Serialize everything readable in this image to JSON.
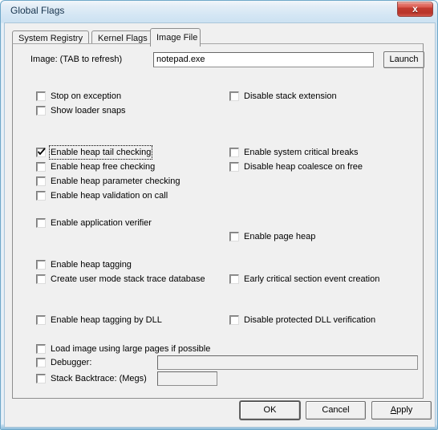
{
  "window": {
    "title": "Global Flags",
    "close_label": "x",
    "close_icon": "close-icon",
    "accent_close": "#c23c31",
    "frame_accent": "#6fa8c9",
    "dialog_background": "#f0f0f0"
  },
  "tabs": [
    {
      "label": "System Registry",
      "active": false
    },
    {
      "label": "Kernel Flags",
      "active": false
    },
    {
      "label": "Image File",
      "active": true
    }
  ],
  "image_row": {
    "label": "Image: (TAB to refresh)",
    "value": "notepad.exe",
    "placeholder": "",
    "launch_label": "Launch"
  },
  "left_column": [
    {
      "label": "Stop on exception",
      "checked": false,
      "focus": false,
      "enabled": true
    },
    {
      "label": "Show loader snaps",
      "checked": false,
      "focus": false,
      "enabled": true
    },
    {
      "label": "Enable heap tail checking",
      "checked": true,
      "focus": true,
      "enabled": true
    },
    {
      "label": "Enable heap free checking",
      "checked": false,
      "focus": false,
      "enabled": true
    },
    {
      "label": "Enable heap parameter checking",
      "checked": false,
      "focus": false,
      "enabled": true
    },
    {
      "label": "Enable heap validation on call",
      "checked": false,
      "focus": false,
      "enabled": true
    },
    {
      "label": "Enable application verifier",
      "checked": false,
      "focus": false,
      "enabled": true
    },
    {
      "label": "Enable heap tagging",
      "checked": false,
      "focus": false,
      "enabled": true
    },
    {
      "label": "Create user mode stack trace database",
      "checked": false,
      "focus": false,
      "enabled": true
    },
    {
      "label": "Enable heap tagging by DLL",
      "checked": false,
      "focus": false,
      "enabled": true
    },
    {
      "label": "Load image using large pages if possible",
      "checked": false,
      "focus": false,
      "enabled": true
    }
  ],
  "right_column": [
    {
      "label": "Disable stack extension",
      "checked": false,
      "focus": false,
      "enabled": true
    },
    {
      "label": "Enable system critical breaks",
      "checked": false,
      "focus": false,
      "enabled": true
    },
    {
      "label": "Disable heap coalesce on free",
      "checked": false,
      "focus": false,
      "enabled": true
    },
    {
      "label": "Enable page heap",
      "checked": false,
      "focus": false,
      "enabled": true
    },
    {
      "label": "Early critical section event creation",
      "checked": false,
      "focus": false,
      "enabled": true
    },
    {
      "label": "Disable protected DLL verification",
      "checked": false,
      "focus": false,
      "enabled": true
    }
  ],
  "debugger_row": {
    "label": "Debugger:",
    "checked": false,
    "value": "",
    "enabled": false
  },
  "stack_backtrace_row": {
    "label": "Stack Backtrace: (Megs)",
    "checked": false,
    "value": "",
    "enabled": false
  },
  "footer": {
    "ok_label": "OK",
    "cancel_label": "Cancel",
    "apply_label_prefix": "A",
    "apply_label_rest": "pply",
    "default_button": "OK"
  }
}
